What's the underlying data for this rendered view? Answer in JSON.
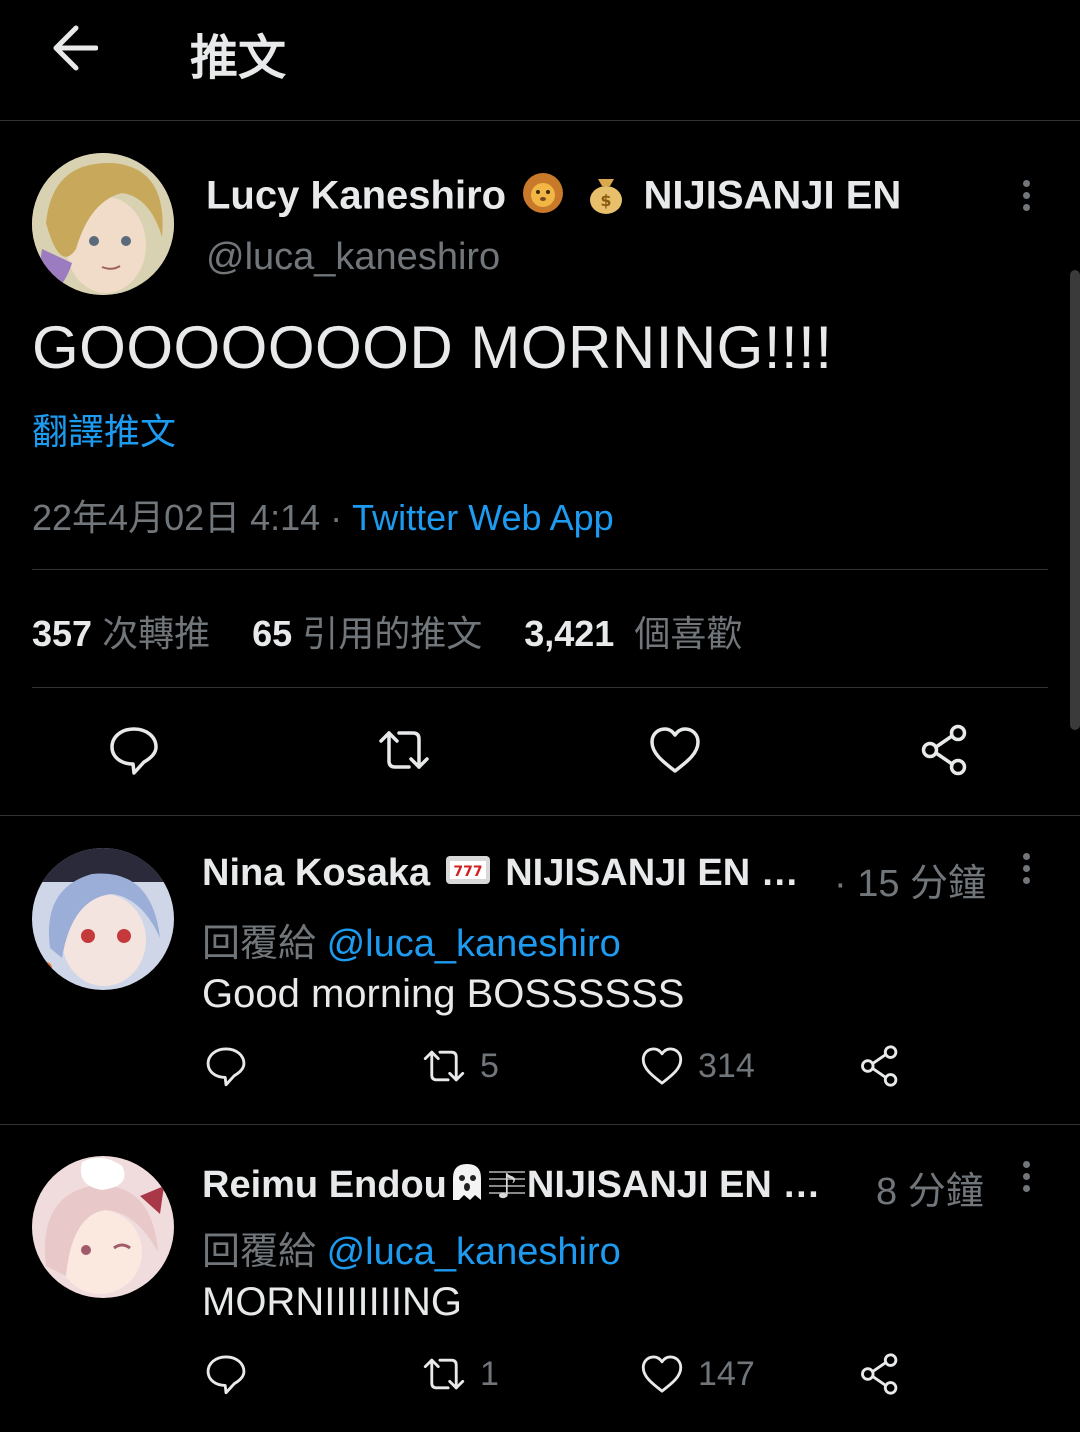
{
  "header": {
    "title": "推文"
  },
  "main_tweet": {
    "author_name": "Lucy Kaneshiro",
    "author_affiliation": "NIJISANJI EN",
    "author_handle": "@luca_kaneshiro",
    "text": "GOOOOOOOD MORNING!!!!",
    "translate_label": "翻譯推文",
    "timestamp": "22年4月02日 4:14 · ",
    "source": "Twitter Web App",
    "stats": {
      "retweets_count": "357",
      "retweets_label": "次轉推",
      "quotes_count": "65",
      "quotes_label": "引用的推文",
      "likes_count": "3,421",
      "likes_label": "個喜歡"
    },
    "icons": [
      "reply-icon",
      "retweet-icon",
      "like-icon",
      "share-icon"
    ]
  },
  "replies": [
    {
      "author_name": "Nina Kosaka",
      "author_affiliation": "NIJISANJI EN …",
      "time": "· 15 分鐘",
      "reply_prefix": "回覆給",
      "reply_to": "@luca_kaneshiro",
      "text": "Good morning BOSSSSSS",
      "retweets": "5",
      "likes": "314"
    },
    {
      "author_name": "Reimu Endou",
      "author_affiliation": "NIJISANJI EN …",
      "time": "8 分鐘",
      "reply_prefix": "回覆給",
      "reply_to": "@luca_kaneshiro",
      "text": "MORNIIIIIIING",
      "retweets": "1",
      "likes": "147"
    }
  ],
  "colors": {
    "accent": "#1d9bf0",
    "muted": "#71767b",
    "text": "#e7e9ea",
    "background": "#000000",
    "divider": "#2f3336"
  }
}
